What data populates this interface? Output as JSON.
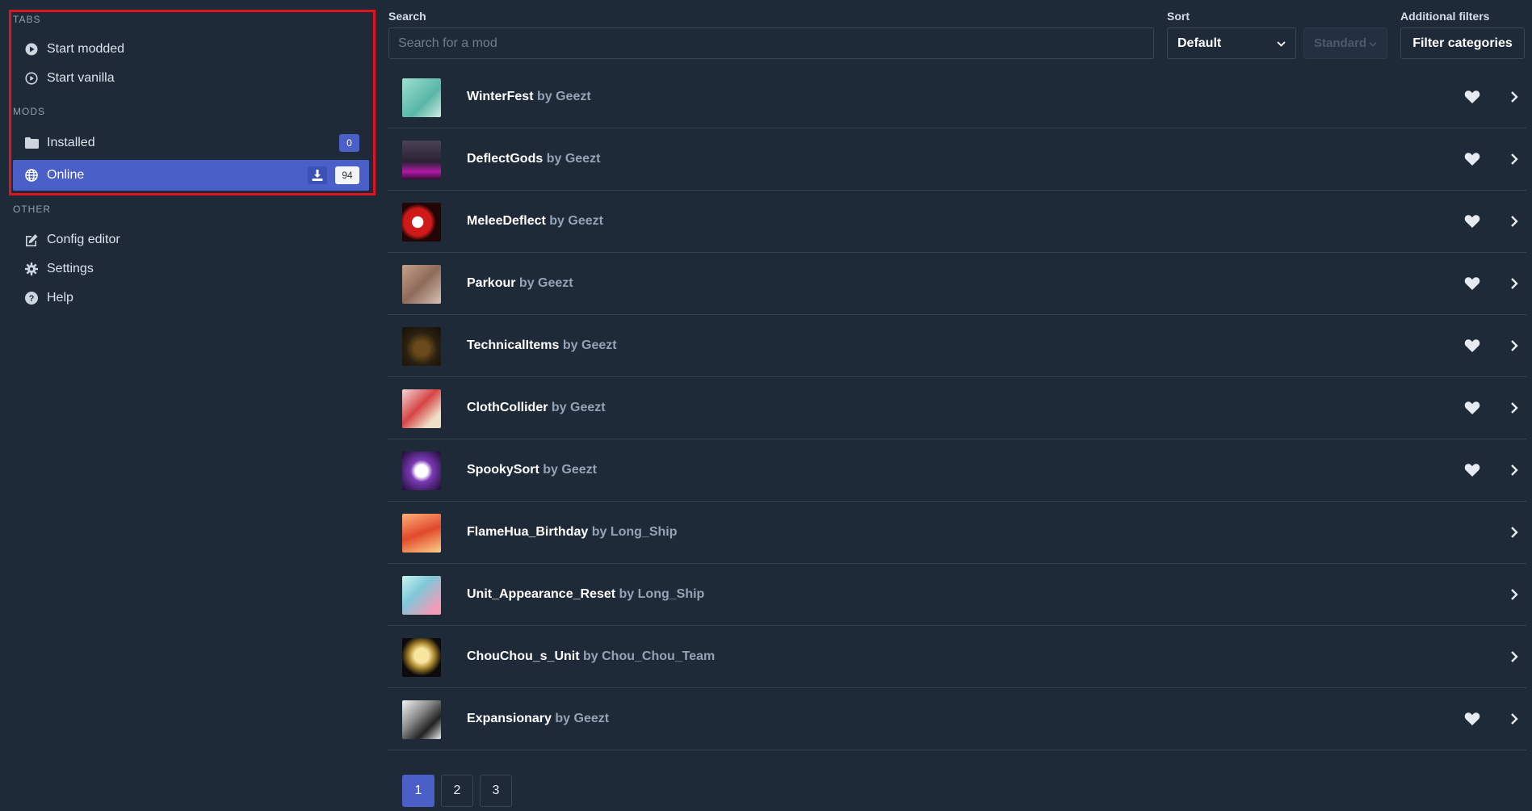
{
  "sidebar": {
    "sections": {
      "tabs": "TABS",
      "mods": "MODS",
      "other": "OTHER"
    },
    "tabs": [
      {
        "label": "Start modded",
        "icon": "play-circle-icon"
      },
      {
        "label": "Start vanilla",
        "icon": "play-circle-outline-icon"
      }
    ],
    "mods": [
      {
        "label": "Installed",
        "icon": "folder-icon",
        "badge": "0"
      },
      {
        "label": "Online",
        "icon": "globe-icon",
        "badge": "94",
        "active": true
      }
    ],
    "other": [
      {
        "label": "Config editor",
        "icon": "edit-icon"
      },
      {
        "label": "Settings",
        "icon": "gear-icon"
      },
      {
        "label": "Help",
        "icon": "question-circle-icon"
      }
    ]
  },
  "filters": {
    "search_label": "Search",
    "search_placeholder": "Search for a mod",
    "sort_label": "Sort",
    "sort_value": "Default",
    "sort_secondary_value": "Standard",
    "additional_label": "Additional filters",
    "filter_button": "Filter categories"
  },
  "mods": [
    {
      "name": "WinterFest",
      "by": "by Geezt",
      "favorited": true
    },
    {
      "name": "DeflectGods",
      "by": "by Geezt",
      "favorited": true
    },
    {
      "name": "MeleeDeflect",
      "by": "by Geezt",
      "favorited": true
    },
    {
      "name": "Parkour",
      "by": "by Geezt",
      "favorited": true
    },
    {
      "name": "TechnicalItems",
      "by": "by Geezt",
      "favorited": true
    },
    {
      "name": "ClothCollider",
      "by": "by Geezt",
      "favorited": true
    },
    {
      "name": "SpookySort",
      "by": "by Geezt",
      "favorited": true
    },
    {
      "name": "FlameHua_Birthday",
      "by": "by Long_Ship",
      "favorited": false
    },
    {
      "name": "Unit_Appearance_Reset",
      "by": "by Long_Ship",
      "favorited": false
    },
    {
      "name": "ChouChou_s_Unit",
      "by": "by Chou_Chou_Team",
      "favorited": false
    },
    {
      "name": "Expansionary",
      "by": "by Geezt",
      "favorited": true
    }
  ],
  "pagination": {
    "pages": [
      "1",
      "2",
      "3"
    ],
    "current": "1"
  },
  "colors": {
    "background": "#1f2a38",
    "accent": "#4a5fc8",
    "selection_outline": "#e0141e",
    "author_text": "#94a4b6"
  }
}
